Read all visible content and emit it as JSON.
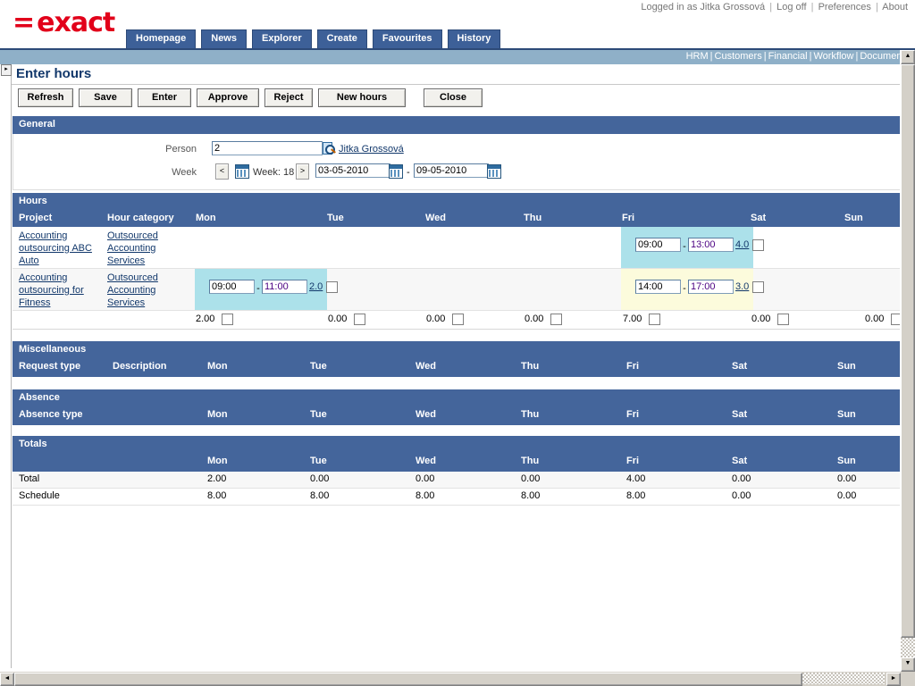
{
  "header": {
    "logo_equals": "=",
    "logo_text": "exact",
    "logged_in_text": "Logged in as Jitka Grossová",
    "user_links": [
      "Log off",
      "Preferences",
      "About"
    ],
    "nav_tabs": [
      "Homepage",
      "News",
      "Explorer",
      "Create",
      "Favourites",
      "History"
    ],
    "module_links": [
      "HRM",
      "Customers",
      "Financial",
      "Workflow",
      "Documents"
    ]
  },
  "page": {
    "title": "Enter hours",
    "collapse_icon": "▸"
  },
  "toolbar": {
    "buttons": [
      "Refresh",
      "Save",
      "Enter",
      "Approve",
      "Reject",
      "New hours",
      "Close"
    ]
  },
  "general": {
    "section_title": "General",
    "person_label": "Person",
    "person_value": "2",
    "person_name_link": "Jitka Grossová",
    "week_label": "Week",
    "prev_symbol": "<",
    "next_symbol": ">",
    "week_text": "Week: 18",
    "date_from": "03-05-2010",
    "date_separator": "-",
    "date_to": "09-05-2010"
  },
  "hours": {
    "section_title": "Hours",
    "columns": [
      "Project",
      "Hour category",
      "Mon",
      "Tue",
      "Wed",
      "Thu",
      "Fri",
      "Sat",
      "Sun"
    ],
    "rows": [
      {
        "project": "Accounting outsourcing ABC Auto",
        "hour_category": "Outsourced Accounting Services",
        "entries": {
          "Fri": {
            "from": "09:00",
            "to": "13:00",
            "hours": "4.0",
            "highlight": "blue",
            "checked": false
          }
        }
      },
      {
        "project": "Accounting outsourcing for Fitness",
        "hour_category": "Outsourced Accounting Services",
        "entries": {
          "Mon": {
            "from": "09:00",
            "to": "11:00",
            "hours": "2.0",
            "highlight": "blue",
            "checked": false
          },
          "Fri": {
            "from": "14:00",
            "to": "17:00",
            "hours": "3.0",
            "highlight": "yellow",
            "checked": false
          }
        }
      }
    ],
    "day_totals": {
      "Mon": "2.00",
      "Tue": "0.00",
      "Wed": "0.00",
      "Thu": "0.00",
      "Fri": "7.00",
      "Sat": "0.00",
      "Sun": "0.00"
    },
    "time_separator": "-"
  },
  "miscellaneous": {
    "section_title": "Miscellaneous",
    "columns": [
      "Request type",
      "Description",
      "Mon",
      "Tue",
      "Wed",
      "Thu",
      "Fri",
      "Sat",
      "Sun"
    ]
  },
  "absence": {
    "section_title": "Absence",
    "columns": [
      "Absence type",
      "",
      "Mon",
      "Tue",
      "Wed",
      "Thu",
      "Fri",
      "Sat",
      "Sun"
    ]
  },
  "totals": {
    "section_title": "Totals",
    "columns": [
      "",
      "Mon",
      "Tue",
      "Wed",
      "Thu",
      "Fri",
      "Sat",
      "Sun"
    ],
    "rows": [
      {
        "label": "Total",
        "values": [
          "2.00",
          "0.00",
          "0.00",
          "0.00",
          "4.00",
          "0.00",
          "0.00"
        ]
      },
      {
        "label": "Schedule",
        "values": [
          "8.00",
          "8.00",
          "8.00",
          "8.00",
          "8.00",
          "0.00",
          "0.00"
        ]
      }
    ]
  },
  "colors": {
    "brand_red": "#e2001a",
    "panel_blue": "#44659b",
    "tab_blue": "#3d6098",
    "module_bar": "#8fb0c8",
    "cell_blue": "#ace1ea",
    "cell_yellow": "#fcfbdc",
    "link_blue": "#12386b"
  },
  "scrollbars": {
    "up_arrow": "▲",
    "down_arrow": "▼",
    "left_arrow": "◄",
    "right_arrow": "►"
  }
}
